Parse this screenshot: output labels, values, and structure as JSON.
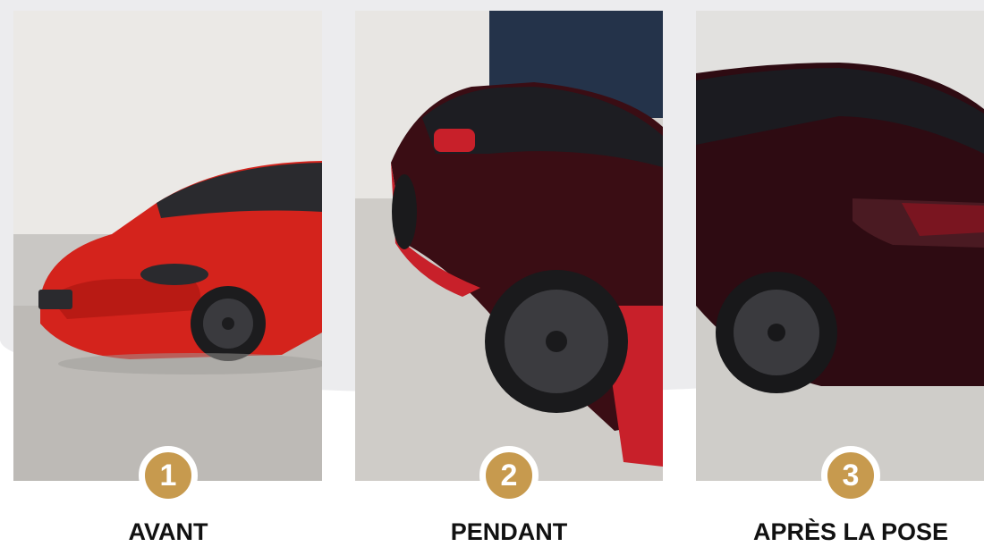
{
  "steps": [
    {
      "number": "1",
      "label": "AVANT",
      "image": "red-tesla-model-3-photo",
      "car_color": "#d4231c"
    },
    {
      "number": "2",
      "label": "PENDANT",
      "image": "tesla-wrapping-in-progress-photo",
      "car_color": "#3a0d14"
    },
    {
      "number": "3",
      "label": "APRÈS LA POSE",
      "image": "dark-cherry-wrapped-tesla-photo",
      "car_color": "#2e0b12"
    }
  ],
  "colors": {
    "accent": "#c79a4e",
    "background": "#ececee",
    "text": "#111111"
  }
}
